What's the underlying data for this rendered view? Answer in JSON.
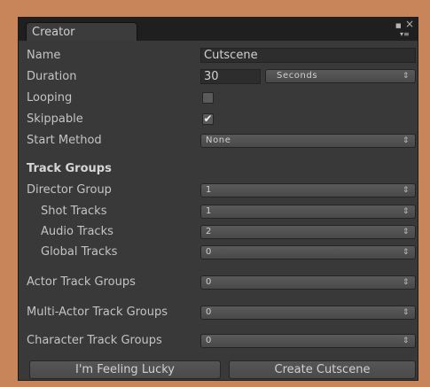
{
  "window": {
    "tab_title": "Creator",
    "maximize_icon": "■",
    "close_icon": "×",
    "menu_icon": "▾≡"
  },
  "form": {
    "name_label": "Name",
    "name_value": "Cutscene",
    "duration_label": "Duration",
    "duration_value": "30",
    "duration_unit": "Seconds",
    "looping_label": "Looping",
    "looping_checked": "",
    "skippable_label": "Skippable",
    "skippable_checked": "✔",
    "start_method_label": "Start Method",
    "start_method_value": "None"
  },
  "track_groups": {
    "heading": "Track Groups",
    "director_group_label": "Director Group",
    "director_group_value": "1",
    "shot_tracks_label": "Shot Tracks",
    "shot_tracks_value": "1",
    "audio_tracks_label": "Audio Tracks",
    "audio_tracks_value": "2",
    "global_tracks_label": "Global Tracks",
    "global_tracks_value": "0",
    "actor_label": "Actor Track Groups",
    "actor_value": "0",
    "multi_actor_label": "Multi-Actor Track Groups",
    "multi_actor_value": "0",
    "character_label": "Character Track Groups",
    "character_value": "0"
  },
  "buttons": {
    "lucky_label": "I'm Feeling Lucky",
    "create_label": "Create Cutscene"
  },
  "icons": {
    "dropdown_arrow": "⇕"
  }
}
